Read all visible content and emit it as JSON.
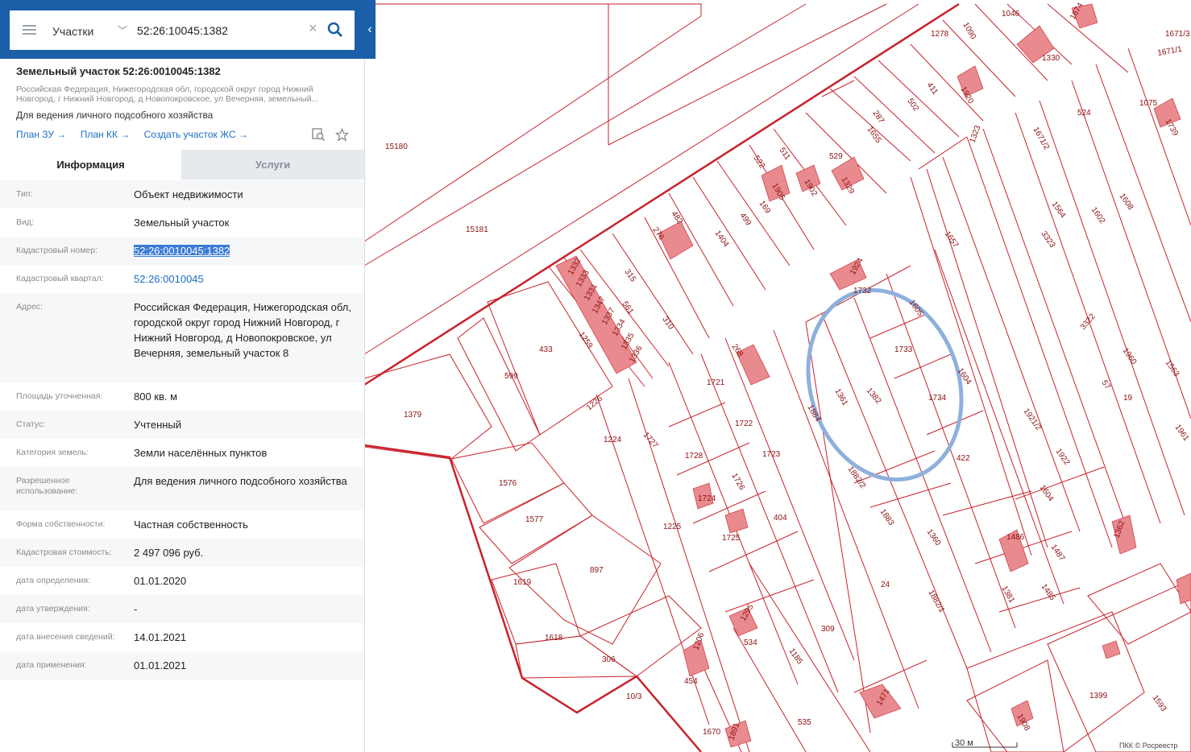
{
  "search": {
    "type_label": "Участки",
    "query": "52:26:10045:1382"
  },
  "object": {
    "title": "Земельный участок 52:26:0010045:1382",
    "address_short": "Российская Федерация, Нижегородская обл, городской округ город Нижний Новгород, г Нижний Новгород, д Новопокровское, ул Вечерняя, земельный...",
    "purpose": "Для ведения личного подсобного хозяйства",
    "links": [
      "План ЗУ →",
      "План КК →",
      "Создать участок ЖС →"
    ]
  },
  "tabs": [
    "Информация",
    "Услуги"
  ],
  "info_rows": [
    {
      "label": "Тип:",
      "value": "Объект недвижимости"
    },
    {
      "label": "Вид:",
      "value": "Земельный участок"
    },
    {
      "label": "Кадастровый номер:",
      "value": "52:26:0010045:1382"
    },
    {
      "label": "Кадастровый квартал:",
      "value": "52:26:0010045"
    },
    {
      "label": "Адрес:",
      "value": "Российская Федерация, Нижегородская обл, городской округ город Нижний Новгород, г Нижний Новгород, д Новопокровское, ул Вечерняя, земельный участок 8"
    },
    {
      "label": "Площадь уточненная:",
      "value": "800 кв. м"
    },
    {
      "label": "Статус:",
      "value": "Учтенный"
    },
    {
      "label": "Категория земель:",
      "value": "Земли населённых пунктов"
    },
    {
      "label": "Разрешенное использование:",
      "value": "Для ведения личного подсобного хозяйства"
    },
    {
      "label": "Форма собственности:",
      "value": "Частная собственность"
    },
    {
      "label": "Кадастровая стоимость:",
      "value": "2 497 096 руб."
    },
    {
      "label": "дата определения:",
      "value": "01.01.2020"
    },
    {
      "label": "дата утверждения:",
      "value": "-"
    },
    {
      "label": "дата внесения сведений:",
      "value": "14.01.2021"
    },
    {
      "label": "дата применения:",
      "value": "01.01.2021"
    }
  ],
  "map": {
    "parcel_labels": [
      "15180",
      "15181",
      "1379",
      "599",
      "433",
      "1576",
      "1577",
      "1619",
      "1618",
      "897",
      "306",
      "10/3",
      "1226",
      "1224",
      "1727",
      "1225",
      "1721",
      "1722",
      "1728",
      "1726",
      "1724",
      "1725",
      "1723",
      "404",
      "1884",
      "1361",
      "1382",
      "1733",
      "1734",
      "1732",
      "1605",
      "1604",
      "422",
      "1882/2",
      "1883",
      "1360",
      "24",
      "309",
      "534",
      "1185",
      "454",
      "1670",
      "535",
      "1882/1",
      "1381",
      "1657",
      "57",
      "19",
      "1921/2",
      "1922",
      "1604",
      "1486",
      "1487",
      "1485",
      "1362",
      "1399",
      "1593",
      "1563",
      "1961",
      "3322",
      "1960",
      "1564",
      "1602",
      "1608",
      "3323",
      "524",
      "1075",
      "1046",
      "1278",
      "1090",
      "411",
      "502",
      "287",
      "1655",
      "529",
      "511",
      "522",
      "169",
      "499",
      "1404",
      "482",
      "276",
      "315",
      "561",
      "310",
      "1259",
      "268",
      "1332",
      "1333",
      "1331",
      "1347",
      "1337",
      "1334",
      "1335",
      "1336",
      "1671/2",
      "1671/3",
      "1671/1",
      "1323",
      "1322",
      "1924",
      "1902",
      "1905",
      "1329",
      "1330",
      "1739",
      "1920",
      "1295",
      "1206",
      "1471",
      "1891",
      "1908",
      "1674"
    ],
    "scale_label": "30 м",
    "copyright": "ПКК © Росреестр",
    "colors": {
      "boundary": "#c8222b",
      "building": "#e88a8e",
      "highlight": "#8eb0dc",
      "panel_header": "#1a5fa8"
    }
  }
}
